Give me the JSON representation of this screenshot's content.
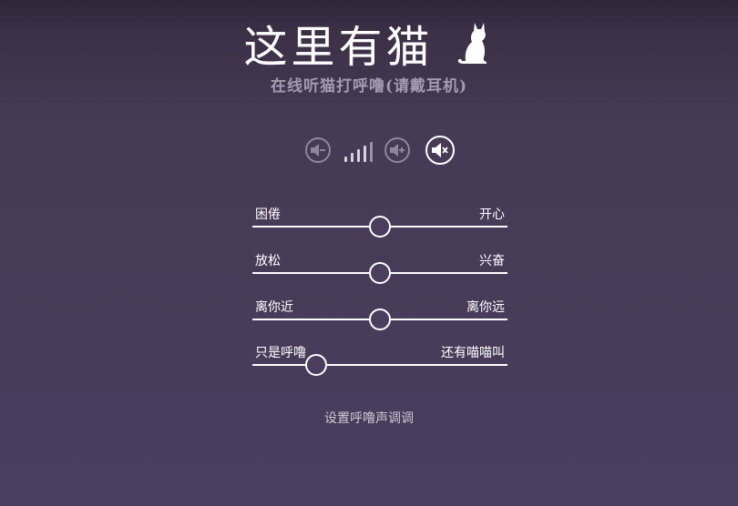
{
  "header": {
    "title": "这里有猫",
    "subtitle": "在线听猫打呼噜(请戴耳机)"
  },
  "volume": {
    "level_bars_total": 5,
    "level_bars_lit": 5,
    "muted_active": true,
    "icons": [
      "volume-down-icon",
      "volume-level-icon",
      "volume-up-icon",
      "mute-icon"
    ]
  },
  "sliders": [
    {
      "left_label": "困倦",
      "right_label": "开心",
      "value": 0.5
    },
    {
      "left_label": "放松",
      "right_label": "兴奋",
      "value": 0.5
    },
    {
      "left_label": "离你近",
      "right_label": "离你远",
      "value": 0.5
    },
    {
      "left_label": "只是呼噜",
      "right_label": "还有喵喵叫",
      "value": 0.25
    }
  ],
  "footer": {
    "link_text": "设置呼噜声调调"
  },
  "colors": {
    "background_top": "#2f2639",
    "background_bottom": "#4a3d5e",
    "subtitle": "#a49bb0",
    "inactive_button": "#8f8799",
    "active_button": "#ffffff"
  }
}
